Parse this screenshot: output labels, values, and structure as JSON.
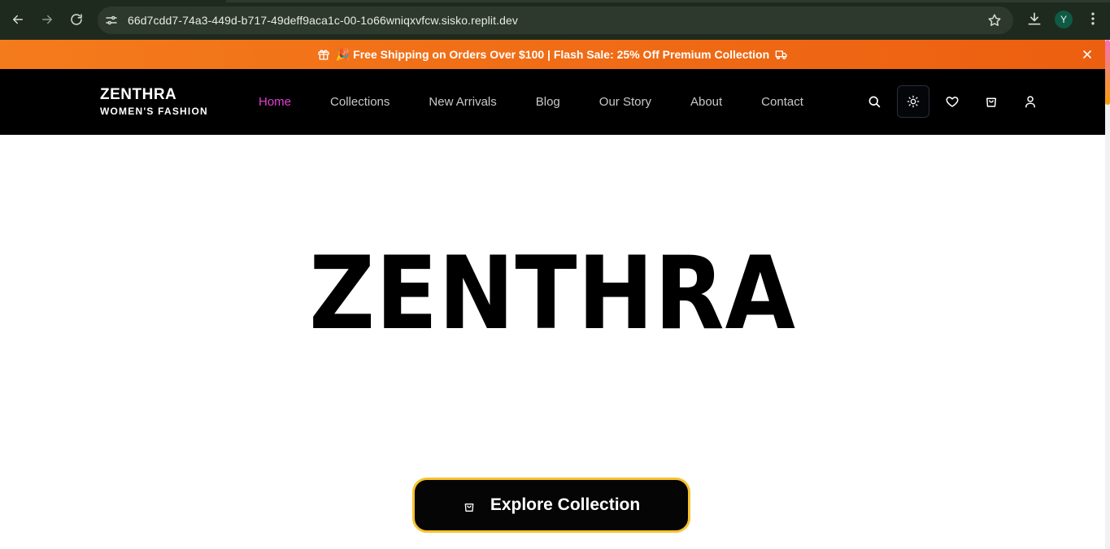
{
  "browser": {
    "url": "66d7cdd7-74a3-449d-b717-49deff9aca1c-00-1o66wniqxvfcw.sisko.replit.dev",
    "profile_initial": "Y",
    "icons": [
      "back-arrow-icon",
      "forward-arrow-icon",
      "reload-icon",
      "site-info-icon",
      "bookmark-star-icon",
      "download-icon",
      "kebab-menu-icon"
    ]
  },
  "promo": {
    "text": "🎉 Free Shipping on Orders Over $100 | Flash Sale: 25% Off Premium Collection",
    "icons": [
      "gift-icon",
      "truck-icon",
      "close-icon"
    ]
  },
  "header": {
    "brand": "ZENTHRA",
    "tagline": "WOMEN'S FASHION",
    "nav": [
      {
        "label": "Home",
        "active": true
      },
      {
        "label": "Collections"
      },
      {
        "label": "New Arrivals"
      },
      {
        "label": "Blog"
      },
      {
        "label": "Our Story"
      },
      {
        "label": "About"
      },
      {
        "label": "Contact"
      }
    ],
    "actions": [
      "search-icon",
      "sun-icon",
      "heart-icon",
      "shopping-bag-icon",
      "user-icon"
    ]
  },
  "hero": {
    "title": "ZENTHRA",
    "cta_label": "Explore Collection"
  },
  "colors": {
    "promo_start": "#f47b1c",
    "promo_end": "#ec5f10",
    "nav_active": "#e43fd2",
    "cta_border": "#f6c32c",
    "header_bg": "#000000"
  }
}
